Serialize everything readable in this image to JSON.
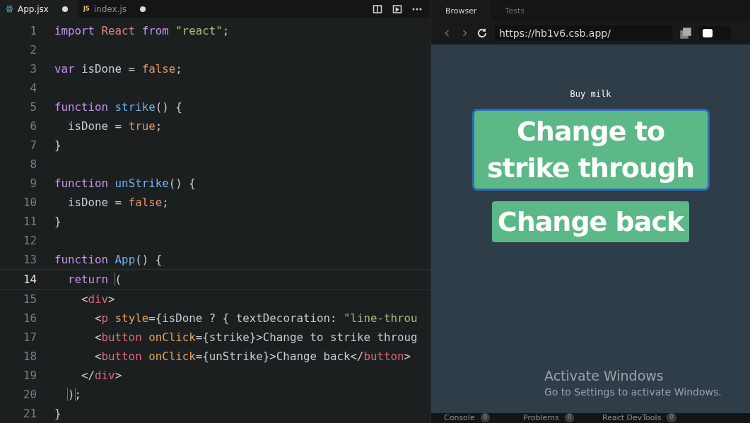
{
  "editor": {
    "tabs": [
      {
        "label": "App.jsx",
        "selected": true,
        "modified": true
      },
      {
        "label": "index.js",
        "badge": "JS",
        "selected": false,
        "modified": true
      }
    ],
    "lines": [
      {
        "number": "1",
        "active": false,
        "tokens": [
          {
            "kind": "keyword",
            "text": "import "
          },
          {
            "kind": "name",
            "text": "React "
          },
          {
            "kind": "keyword",
            "text": "from "
          },
          {
            "kind": "string",
            "text": "\"react\""
          },
          {
            "kind": "plain",
            "text": ";"
          }
        ]
      },
      {
        "number": "2",
        "active": false
      },
      {
        "number": "3",
        "active": false,
        "tokens": [
          {
            "kind": "keyword",
            "text": "var "
          },
          {
            "kind": "plain",
            "text": "isDone = "
          },
          {
            "kind": "literal",
            "text": "false"
          },
          {
            "kind": "plain",
            "text": ";"
          }
        ]
      },
      {
        "number": "4",
        "active": false
      },
      {
        "number": "5",
        "active": false,
        "tokens": [
          {
            "kind": "keyword",
            "text": "function "
          },
          {
            "kind": "function",
            "text": "strike"
          },
          {
            "kind": "plain",
            "text": "() {"
          }
        ]
      },
      {
        "number": "6",
        "active": false,
        "tokens": [
          {
            "kind": "plain",
            "text": "  isDone = "
          },
          {
            "kind": "literal",
            "text": "true"
          },
          {
            "kind": "plain",
            "text": ";"
          }
        ]
      },
      {
        "number": "7",
        "active": false,
        "tokens": [
          {
            "kind": "plain",
            "text": "}"
          }
        ]
      },
      {
        "number": "8",
        "active": false
      },
      {
        "number": "9",
        "active": false,
        "tokens": [
          {
            "kind": "keyword",
            "text": "function "
          },
          {
            "kind": "function",
            "text": "unStrike"
          },
          {
            "kind": "plain",
            "text": "() {"
          }
        ]
      },
      {
        "number": "10",
        "active": false,
        "tokens": [
          {
            "kind": "plain",
            "text": "  isDone = "
          },
          {
            "kind": "literal",
            "text": "false"
          },
          {
            "kind": "plain",
            "text": ";"
          }
        ]
      },
      {
        "number": "11",
        "active": false,
        "tokens": [
          {
            "kind": "plain",
            "text": "}"
          }
        ]
      },
      {
        "number": "12",
        "active": false
      },
      {
        "number": "13",
        "active": false,
        "tokens": [
          {
            "kind": "keyword",
            "text": "function "
          },
          {
            "kind": "function",
            "text": "App"
          },
          {
            "kind": "plain",
            "text": "() {"
          }
        ]
      },
      {
        "number": "14",
        "active": true,
        "tokens": [
          {
            "kind": "keyword",
            "text": "  return "
          },
          {
            "kind": "bracket",
            "text": "("
          }
        ]
      },
      {
        "number": "15",
        "active": false,
        "tokens": [
          {
            "kind": "plain",
            "text": "    <"
          },
          {
            "kind": "tag",
            "text": "div"
          },
          {
            "kind": "plain",
            "text": ">"
          }
        ]
      },
      {
        "number": "16",
        "active": false,
        "tokens": [
          {
            "kind": "plain",
            "text": "      <"
          },
          {
            "kind": "tag",
            "text": "p "
          },
          {
            "kind": "attr",
            "text": "style"
          },
          {
            "kind": "plain",
            "text": "={isDone ? { textDecoration: "
          },
          {
            "kind": "string",
            "text": "\"line-throu"
          }
        ]
      },
      {
        "number": "17",
        "active": false,
        "tokens": [
          {
            "kind": "plain",
            "text": "      <"
          },
          {
            "kind": "tag",
            "text": "button "
          },
          {
            "kind": "attr",
            "text": "onClick"
          },
          {
            "kind": "plain",
            "text": "={strike}>Change to strike throug"
          }
        ]
      },
      {
        "number": "18",
        "active": false,
        "tokens": [
          {
            "kind": "plain",
            "text": "      <"
          },
          {
            "kind": "tag",
            "text": "button "
          },
          {
            "kind": "attr",
            "text": "onClick"
          },
          {
            "kind": "plain",
            "text": "={unStrike}>Change back</"
          },
          {
            "kind": "tag",
            "text": "button"
          },
          {
            "kind": "plain",
            "text": ">"
          }
        ]
      },
      {
        "number": "19",
        "active": false,
        "tokens": [
          {
            "kind": "plain",
            "text": "    </"
          },
          {
            "kind": "tag",
            "text": "div"
          },
          {
            "kind": "plain",
            "text": ">"
          }
        ]
      },
      {
        "number": "20",
        "active": false,
        "tokens": [
          {
            "kind": "bracket",
            "text": "  )"
          },
          {
            "kind": "plain",
            "text": ";"
          }
        ]
      },
      {
        "number": "21",
        "active": false,
        "tokens": [
          {
            "kind": "plain",
            "text": "}"
          }
        ]
      }
    ]
  },
  "browser": {
    "tabs": [
      {
        "label": "Browser",
        "selected": true
      },
      {
        "label": "Tests",
        "selected": false
      }
    ],
    "url": "https://hb1v6.csb.app/",
    "page": {
      "text": "Buy milk",
      "buttons": [
        {
          "label": "Change to strike through",
          "focused": true
        },
        {
          "label": "Change back",
          "focused": false
        }
      ]
    },
    "watermark": {
      "title": "Activate Windows",
      "subtitle": "Go to Settings to activate Windows."
    },
    "bottom_tabs": [
      {
        "label": "Console",
        "count": "0"
      },
      {
        "label": "Problems",
        "count": "0"
      },
      {
        "label": "React DevTools",
        "count": "0"
      }
    ]
  }
}
